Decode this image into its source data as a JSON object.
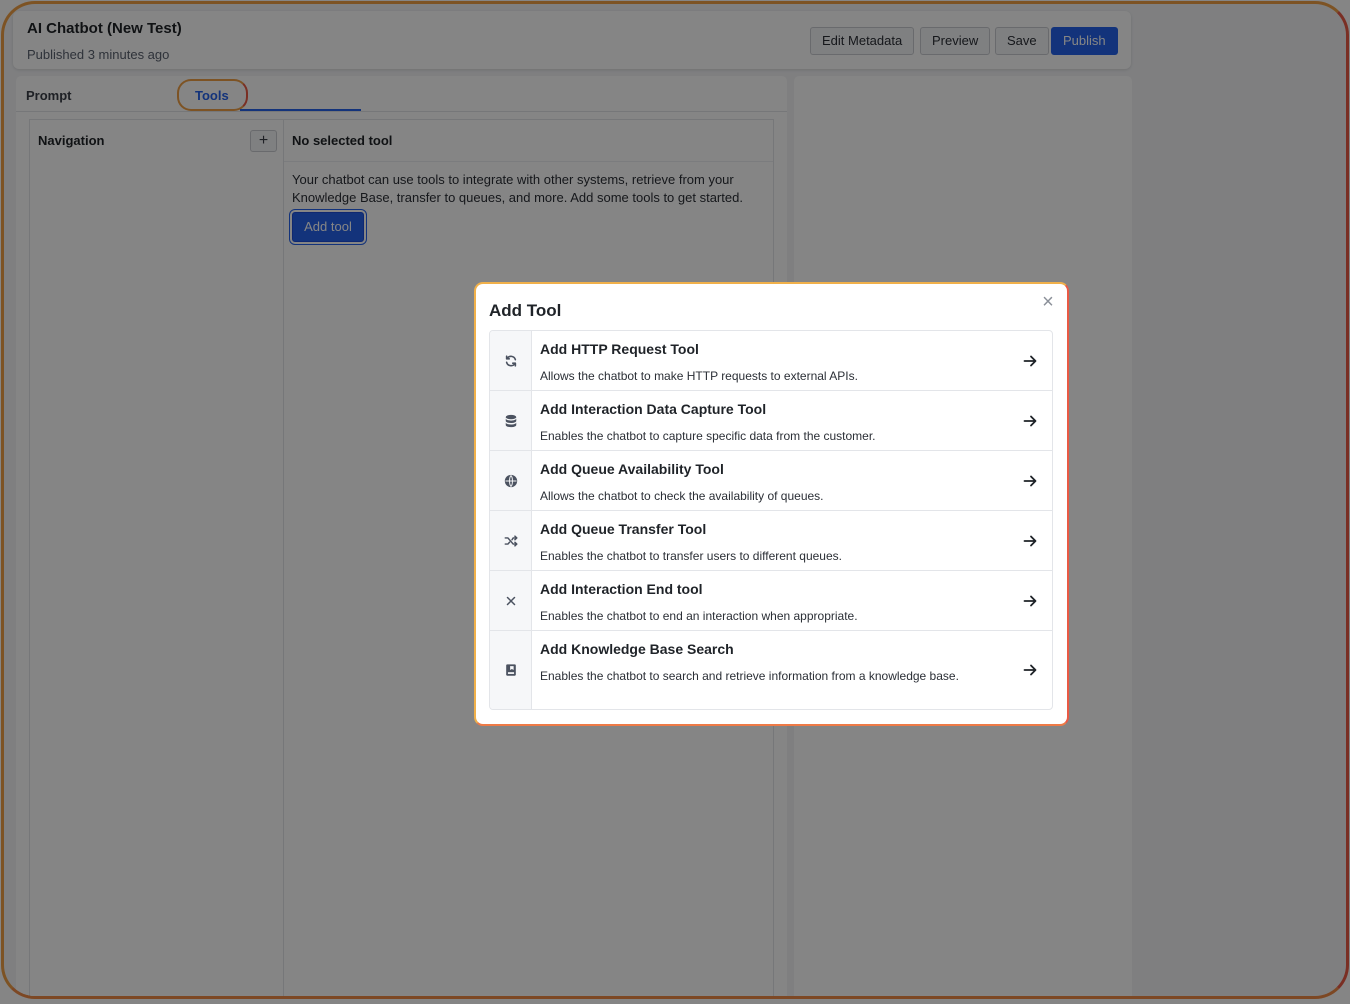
{
  "header": {
    "title": "AI Chatbot (New Test)",
    "subtitle": "Published 3 minutes ago",
    "buttons": {
      "edit_metadata": "Edit Metadata",
      "preview": "Preview",
      "save": "Save",
      "publish": "Publish"
    }
  },
  "tabs": {
    "prompt": "Prompt",
    "tools": "Tools"
  },
  "navigation": {
    "title": "Navigation",
    "add_label": "+"
  },
  "detail": {
    "title": "No selected tool",
    "description": "Your chatbot can use tools to integrate with other systems, retrieve from your Knowledge Base, transfer to queues, and more. Add some tools to get started.",
    "add_tool_label": "Add tool"
  },
  "modal": {
    "title": "Add Tool",
    "close_label": "×",
    "tools": [
      {
        "name": "Add HTTP Request Tool",
        "description": "Allows the chatbot to make HTTP requests to external APIs.",
        "icon": "refresh-icon"
      },
      {
        "name": "Add Interaction Data Capture Tool",
        "description": "Enables the chatbot to capture specific data from the customer.",
        "icon": "database-icon"
      },
      {
        "name": "Add Queue Availability Tool",
        "description": "Allows the chatbot to check the availability of queues.",
        "icon": "globe-icon"
      },
      {
        "name": "Add Queue Transfer Tool",
        "description": "Enables the chatbot to transfer users to different queues.",
        "icon": "shuffle-icon"
      },
      {
        "name": "Add Interaction End tool",
        "description": "Enables the chatbot to end an interaction when appropriate.",
        "icon": "x-icon"
      },
      {
        "name": "Add Knowledge Base Search",
        "description": "Enables the chatbot to search and retrieve information from a knowledge base.",
        "icon": "book-icon"
      }
    ]
  },
  "colors": {
    "accent": "#2563eb",
    "highlight_ring": "#f0a046"
  }
}
